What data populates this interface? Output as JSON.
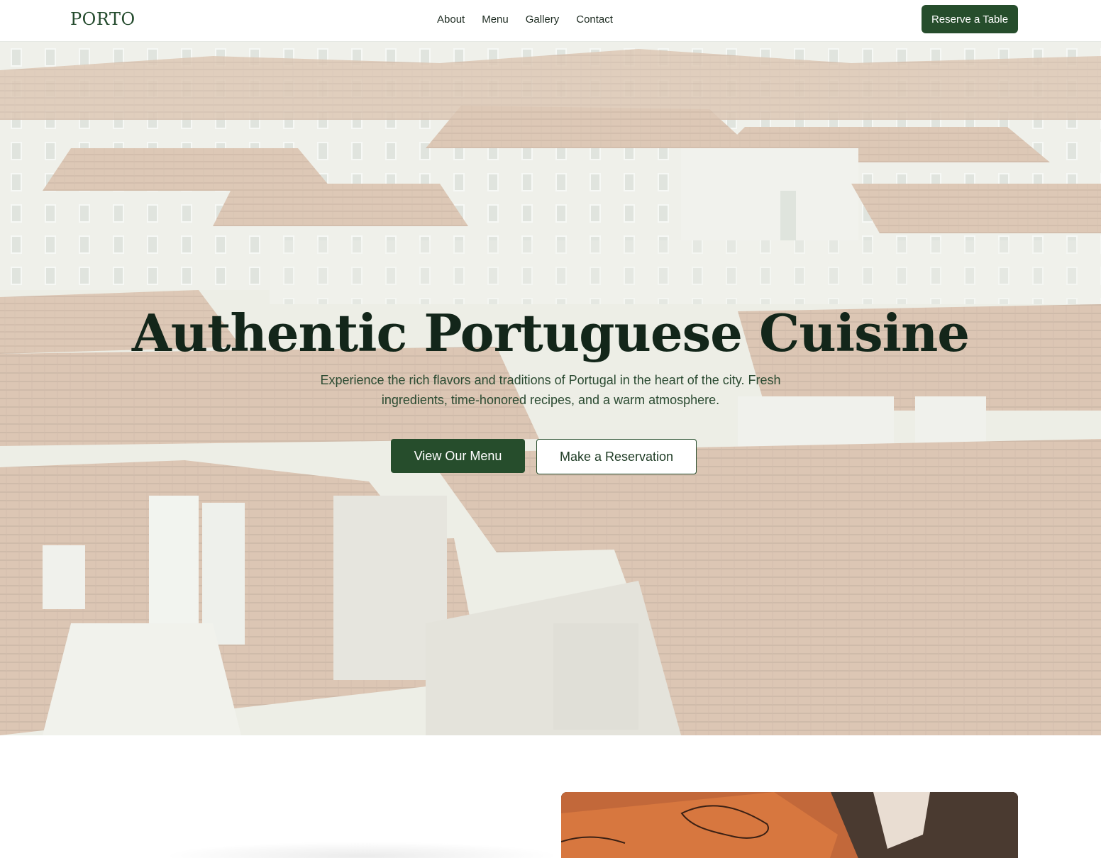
{
  "header": {
    "logo": "PORTO",
    "nav": [
      "About",
      "Menu",
      "Gallery",
      "Contact"
    ],
    "cta_label": "Reserve a Table"
  },
  "hero": {
    "background_icon": "city-rooftops-photo",
    "title": "Authentic Portuguese Cuisine",
    "subtitle": "Experience the rich flavors and traditions of Portugal in the heart of the city. Fresh ingredients, time-honored recipes, and a warm atmosphere.",
    "primary_button": "View Our Menu",
    "secondary_button": "Make a Reservation"
  },
  "about": {
    "image_icon": "chef-tattooed-arm-photo"
  },
  "colors": {
    "brand_green": "#264d2c",
    "title_text": "#13261a",
    "roof_terracotta": "#c98f6a",
    "wall_white": "#f1efe8"
  }
}
